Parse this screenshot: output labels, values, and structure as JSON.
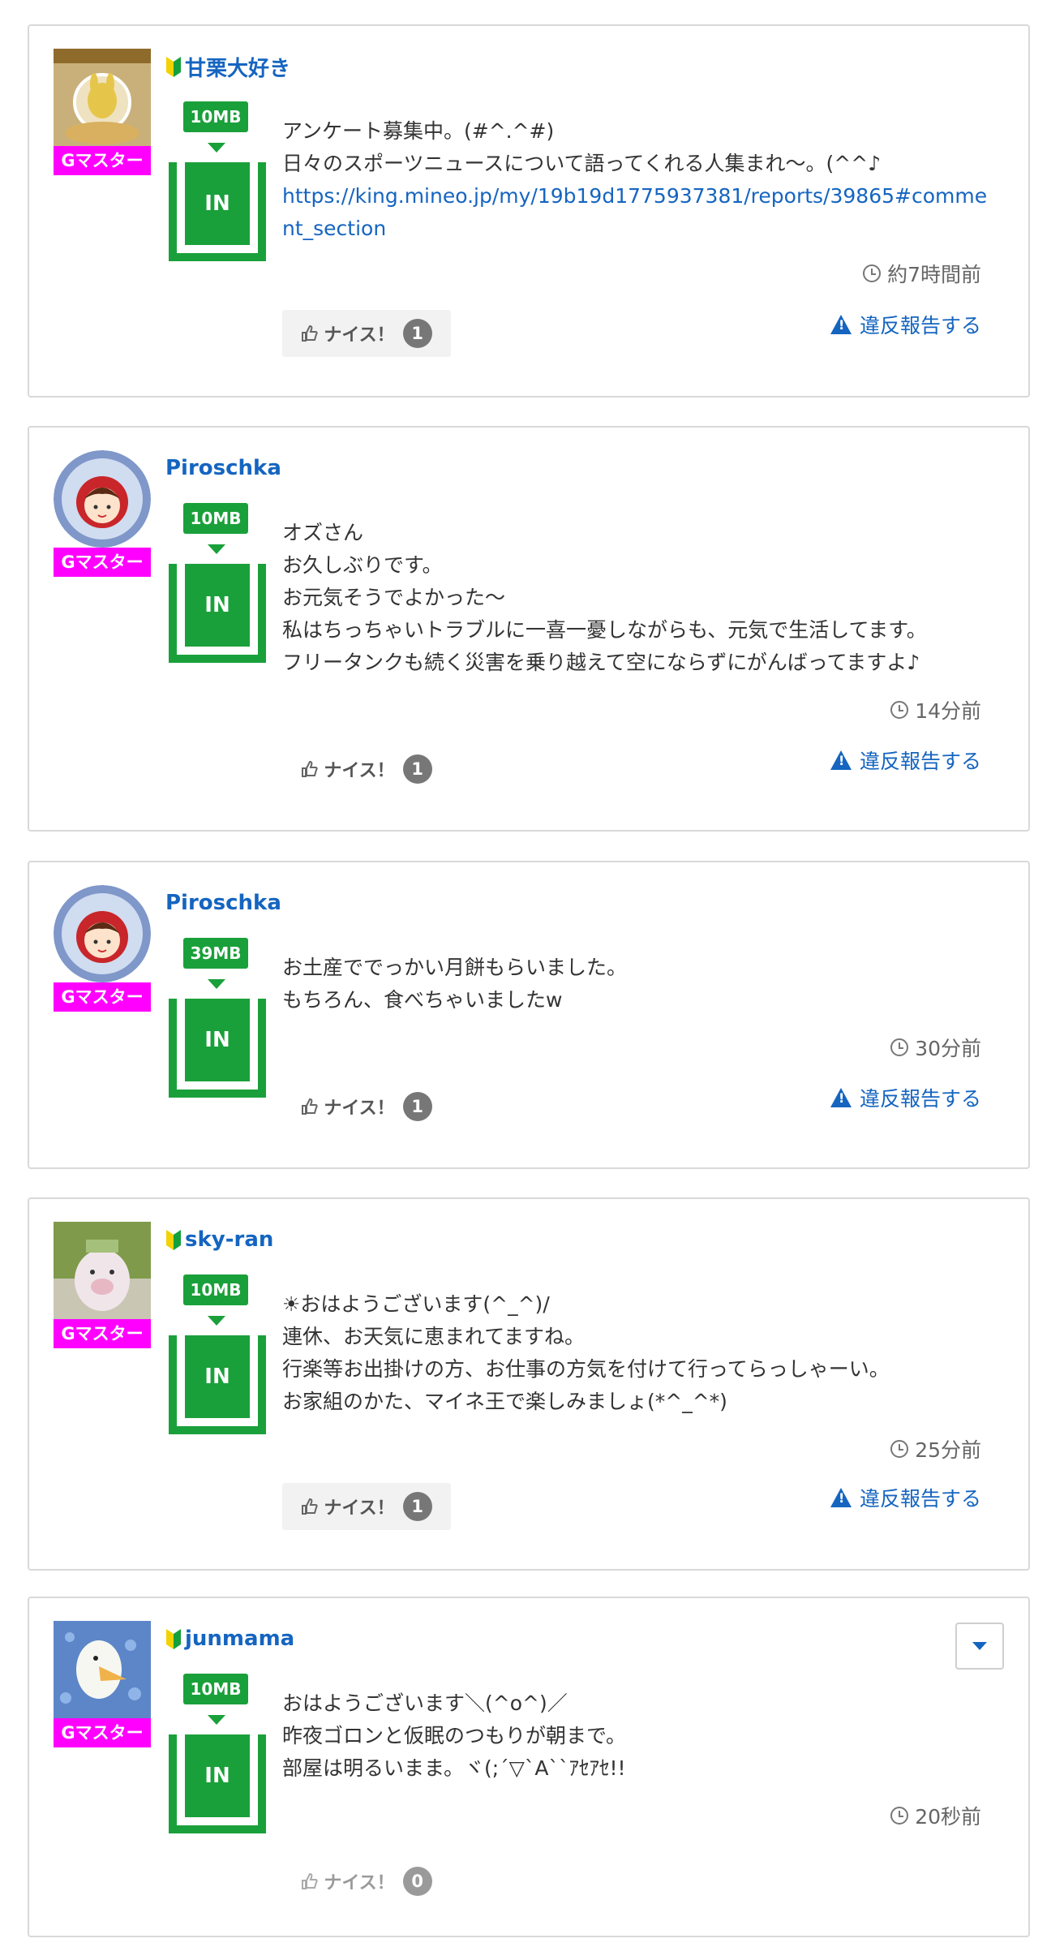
{
  "common": {
    "badge": "Gマスター",
    "in_label": "IN",
    "nice_label": "ナイス！",
    "report_label": "違反報告する"
  },
  "posts": [
    {
      "username": "甘栗大好き",
      "mb": "10MB",
      "lines": [
        "アンケート募集中。(#^.^#)",
        "日々のスポーツニュースについて語ってくれる人集まれ〜。(^^♪"
      ],
      "link": "https://king.mineo.jp/my/19b19d1775937381/reports/39865#comment_section",
      "time": "約7時間前",
      "nice_count": "1"
    },
    {
      "username": "Piroschka",
      "mb": "10MB",
      "lines": [
        "オズさん",
        "お久しぶりです。",
        "お元気そうでよかった〜",
        "私はちっちゃいトラブルに一喜一憂しながらも、元気で生活してます。",
        "フリータンクも続く災害を乗り越えて空にならずにがんばってますよ♪"
      ],
      "time": "14分前",
      "nice_count": "1"
    },
    {
      "username": "Piroschka",
      "mb": "39MB",
      "lines": [
        "お土産ででっかい月餅もらいました。",
        "もちろん、食べちゃいましたw"
      ],
      "time": "30分前",
      "nice_count": "1"
    },
    {
      "username": "sky-ran",
      "mb": "10MB",
      "lines": [
        "☀おはようございます(^_^)/",
        "連休、お天気に恵まれてますね。",
        "行楽等お出掛けの方、お仕事の方気を付けて行ってらっしゃーい。",
        "お家組のかた、マイネ王で楽しみましょ(*^_^*)"
      ],
      "time": "25分前",
      "nice_count": "1"
    },
    {
      "username": "junmama",
      "mb": "10MB",
      "lines": [
        "おはようございます＼(^o^)／",
        "昨夜ゴロンと仮眠のつもりが朝まで。",
        "部屋は明るいまま。ヾ(;´▽`A``ｱｾｱｾ!!"
      ],
      "time": "20秒前",
      "nice_count": "0"
    }
  ]
}
